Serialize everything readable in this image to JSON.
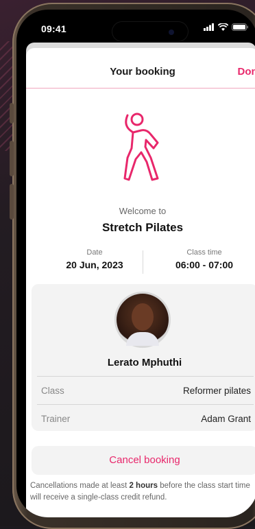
{
  "status_bar": {
    "time": "09:41"
  },
  "header": {
    "title": "Your booking",
    "done_label": "Done"
  },
  "welcome": {
    "prefix": "Welcome to",
    "class_name": "Stretch Pilates"
  },
  "details": {
    "date_label": "Date",
    "date_value": "20 Jun, 2023",
    "time_label": "Class time",
    "time_value": "06:00 - 07:00"
  },
  "member": {
    "name": "Lerato Mphuthi",
    "rows": [
      {
        "label": "Class",
        "value": "Reformer pilates"
      },
      {
        "label": "Trainer",
        "value": "Adam Grant"
      }
    ]
  },
  "cancel_label": "Cancel booking",
  "note": {
    "before": "Cancellations made at least ",
    "bold": "2 hours",
    "after": " before the class start time will receive a single-class credit refund."
  },
  "colors": {
    "accent": "#e8276b",
    "card": "#f3f3f3"
  },
  "icons": [
    "signal-icon",
    "wifi-icon",
    "battery-icon",
    "stretch-person-icon"
  ]
}
